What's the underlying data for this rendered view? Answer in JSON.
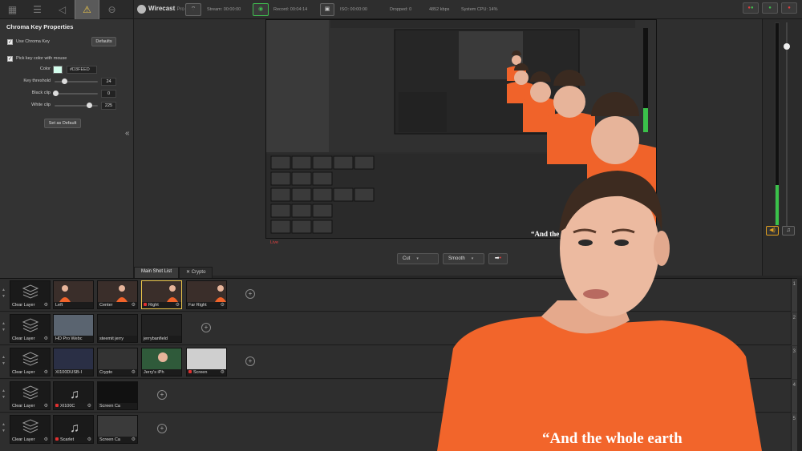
{
  "props": {
    "tabs": [
      "layers-icon",
      "sliders-icon",
      "audio-icon",
      "warning-icon",
      "more-icon"
    ],
    "title": "Chroma Key Properties",
    "use_chroma_key": "Use Chroma Key",
    "defaults": "Defaults",
    "pick_key": "Pick key color with mouse",
    "color_label": "Color",
    "color_hex": "#D3FEED",
    "key_threshold_label": "Key threshold",
    "key_threshold": "24",
    "black_clip_label": "Black clip",
    "black_clip": "0",
    "white_clip_label": "White clip",
    "white_clip": "225",
    "set_default": "Set as Default",
    "collapse": "«"
  },
  "topbar": {
    "brand": "Wirecast",
    "brand_sub": "Pro",
    "stream": "Stream: 00:00:00",
    "record": "Record: 00:04:14",
    "iso": "ISO: 00:00:00",
    "dropped": "Dropped: 0",
    "bitrate": "4852 kbps",
    "cpu": "System CPU: 14%"
  },
  "live_label": "Live",
  "transition": {
    "cut": "Cut",
    "smooth": "Smooth",
    "go": "➡"
  },
  "shotlist_tabs": [
    "Main Shot List",
    "Crypto"
  ],
  "caption": "“And the whole earth",
  "layers": [
    {
      "num": "1",
      "shots": [
        "Clear Layer",
        "Left",
        "Center",
        "Right",
        "Far Right"
      ]
    },
    {
      "num": "2",
      "shots": [
        "Clear Layer",
        "HD Pro Webc",
        "steemit jerry",
        "jerrybanfield"
      ]
    },
    {
      "num": "3",
      "shots": [
        "Clear Layer",
        "XI100DUSB-I",
        "Crypto",
        "Jerry's iPh",
        "Screen"
      ]
    },
    {
      "num": "4",
      "shots": [
        "Clear Layer",
        "XI100C",
        "Screen Ca"
      ]
    },
    {
      "num": "5",
      "shots": [
        "Clear Layer",
        "Scarlet",
        "Screen Ca"
      ]
    }
  ]
}
